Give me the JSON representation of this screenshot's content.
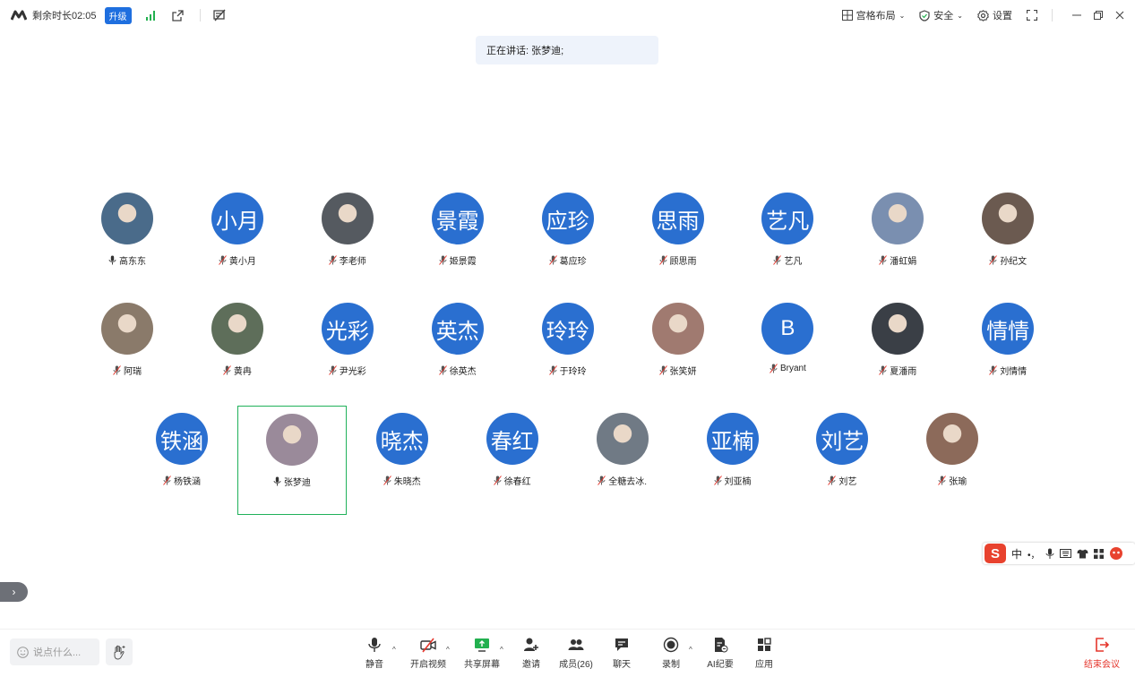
{
  "topbar": {
    "remaining_time": "剩余时长02:05",
    "upgrade_label": "升级",
    "layout_label": "宫格布局",
    "security_label": "安全",
    "settings_label": "设置"
  },
  "speaking": {
    "text": "正在讲话: 张梦迪;"
  },
  "participants": [
    {
      "name": "高东东",
      "avatar_text": "",
      "photo": true,
      "muted": false,
      "active": false
    },
    {
      "name": "黄小月",
      "avatar_text": "小月",
      "photo": false,
      "muted": true,
      "active": false
    },
    {
      "name": "李老师",
      "avatar_text": "",
      "photo": true,
      "muted": true,
      "active": false
    },
    {
      "name": "姬景霞",
      "avatar_text": "景霞",
      "photo": false,
      "muted": true,
      "active": false
    },
    {
      "name": "葛应珍",
      "avatar_text": "应珍",
      "photo": false,
      "muted": true,
      "active": false
    },
    {
      "name": "顾思雨",
      "avatar_text": "思雨",
      "photo": false,
      "muted": true,
      "active": false
    },
    {
      "name": "艺凡",
      "avatar_text": "艺凡",
      "photo": false,
      "muted": true,
      "active": false
    },
    {
      "name": "潘虹娟",
      "avatar_text": "",
      "photo": true,
      "muted": true,
      "active": false
    },
    {
      "name": "孙纪文",
      "avatar_text": "",
      "photo": true,
      "muted": true,
      "active": false
    },
    {
      "name": "阿瑞",
      "avatar_text": "",
      "photo": true,
      "muted": true,
      "active": false
    },
    {
      "name": "黄冉",
      "avatar_text": "",
      "photo": true,
      "muted": true,
      "active": false
    },
    {
      "name": "尹光彩",
      "avatar_text": "光彩",
      "photo": false,
      "muted": true,
      "active": false
    },
    {
      "name": "徐英杰",
      "avatar_text": "英杰",
      "photo": false,
      "muted": true,
      "active": false
    },
    {
      "name": "于玲玲",
      "avatar_text": "玲玲",
      "photo": false,
      "muted": true,
      "active": false
    },
    {
      "name": "张笑妍",
      "avatar_text": "",
      "photo": true,
      "muted": true,
      "active": false
    },
    {
      "name": "Bryant",
      "avatar_text": "B",
      "photo": false,
      "muted": true,
      "active": false
    },
    {
      "name": "夏潘雨",
      "avatar_text": "",
      "photo": true,
      "muted": true,
      "active": false
    },
    {
      "name": "刘情情",
      "avatar_text": "情情",
      "photo": false,
      "muted": true,
      "active": false
    },
    {
      "name": "杨铁涵",
      "avatar_text": "铁涵",
      "photo": false,
      "muted": true,
      "active": false
    },
    {
      "name": "张梦迪",
      "avatar_text": "",
      "photo": true,
      "muted": false,
      "active": true
    },
    {
      "name": "朱晓杰",
      "avatar_text": "晓杰",
      "photo": false,
      "muted": true,
      "active": false
    },
    {
      "name": "徐春红",
      "avatar_text": "春红",
      "photo": false,
      "muted": true,
      "active": false
    },
    {
      "name": "全糖去冰.",
      "avatar_text": "",
      "photo": true,
      "muted": true,
      "active": false
    },
    {
      "name": "刘亚楠",
      "avatar_text": "亚楠",
      "photo": false,
      "muted": true,
      "active": false
    },
    {
      "name": "刘艺",
      "avatar_text": "刘艺",
      "photo": false,
      "muted": true,
      "active": false
    },
    {
      "name": "张瑜",
      "avatar_text": "",
      "photo": true,
      "muted": true,
      "active": false
    }
  ],
  "ime": {
    "lang": "中",
    "punct": "•，"
  },
  "chat": {
    "placeholder": "说点什么..."
  },
  "toolbar": {
    "mute": "静音",
    "video": "开启视频",
    "share": "共享屏幕",
    "invite": "邀请",
    "members": "成员(26)",
    "chat": "聊天",
    "record": "录制",
    "ai_minutes": "AI纪要",
    "apps": "应用",
    "end": "结束会议"
  },
  "colors": {
    "avatar_blue": "#2a6fd0",
    "active_border": "#20b15a",
    "end_red": "#e5362c",
    "upgrade_blue": "#1f6fdf"
  }
}
